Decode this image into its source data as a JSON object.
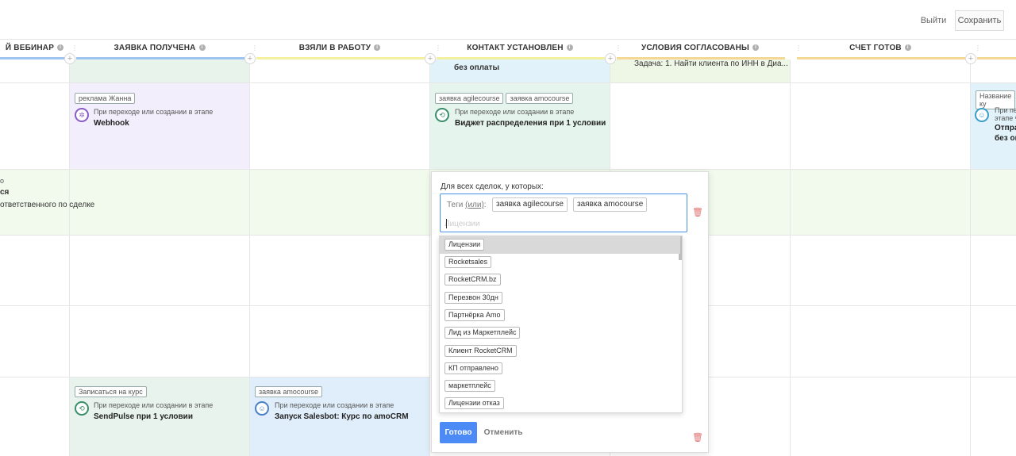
{
  "topbar": {
    "exit_label": "Выйти",
    "save_label": "Сохранить"
  },
  "columns": [
    {
      "title": "Й ВЕБИНАР",
      "color": "#9ec5f0"
    },
    {
      "title": "ЗАЯВКА ПОЛУЧЕНА",
      "color": "#9ec5f0"
    },
    {
      "title": "ВЗЯЛИ В РАБОТУ",
      "color": "#f3f0a0"
    },
    {
      "title": "КОНТАКТ УСТАНОВЛЕН",
      "color": "#f3f0a0"
    },
    {
      "title": "УСЛОВИЯ СОГЛАСОВАНЫ",
      "color": "#f5d896"
    },
    {
      "title": "СЧЕТ ГОТОВ",
      "color": "#f5d896"
    }
  ],
  "row1": {
    "contact_text": "без оплаты",
    "conditions_text": "Задача: 1. Найти клиента по ИНН в Диа..."
  },
  "row2": {
    "received": {
      "tag": "реклама Жанна",
      "sub": "При переходе или создании в этапе",
      "title": "Webhook"
    },
    "contact": {
      "tags": [
        "заявка agilecourse",
        "заявка amocourse"
      ],
      "sub": "При переходе или создании в этапе",
      "title": "Виджет распределения при 1 условии"
    },
    "right": {
      "tag": "Название ку",
      "sub1": "При пере",
      "sub2": "этапе ч",
      "title1": "Отпра",
      "title2": "без оп"
    }
  },
  "row3": {
    "line1": "о",
    "line2": "ся",
    "line3": "ответственного по сделке"
  },
  "row6": {
    "received": {
      "tag": "Записаться на курс",
      "sub": "При переходе или создании в этапе",
      "title": "SendPulse при 1 условии"
    },
    "work": {
      "tag": "заявка amocourse",
      "sub": "При переходе или создании в этапе",
      "title": "Запуск Salesbot: Курс по amoCRM"
    }
  },
  "popup": {
    "label": "Для всех сделок, у которых:",
    "tags_prefix": "Теги",
    "tags_or": "(или)",
    "tags_colon": ":",
    "chips": [
      "заявка agilecourse",
      "заявка amocourse"
    ],
    "input_placeholder": "Лицензии",
    "done_label": "Готово",
    "cancel_label": "Отменить"
  },
  "dropdown": {
    "items": [
      "Лицензии",
      "Rocketsales",
      "RocketCRM.bz",
      "Перезвон 30дн",
      "Партнёрка Amo",
      "Лид из Маркетплейс",
      "Клиент RocketCRM",
      "КП отправлено",
      "маркетплейс",
      "Лицензии отказ"
    ],
    "selected_index": 0
  }
}
